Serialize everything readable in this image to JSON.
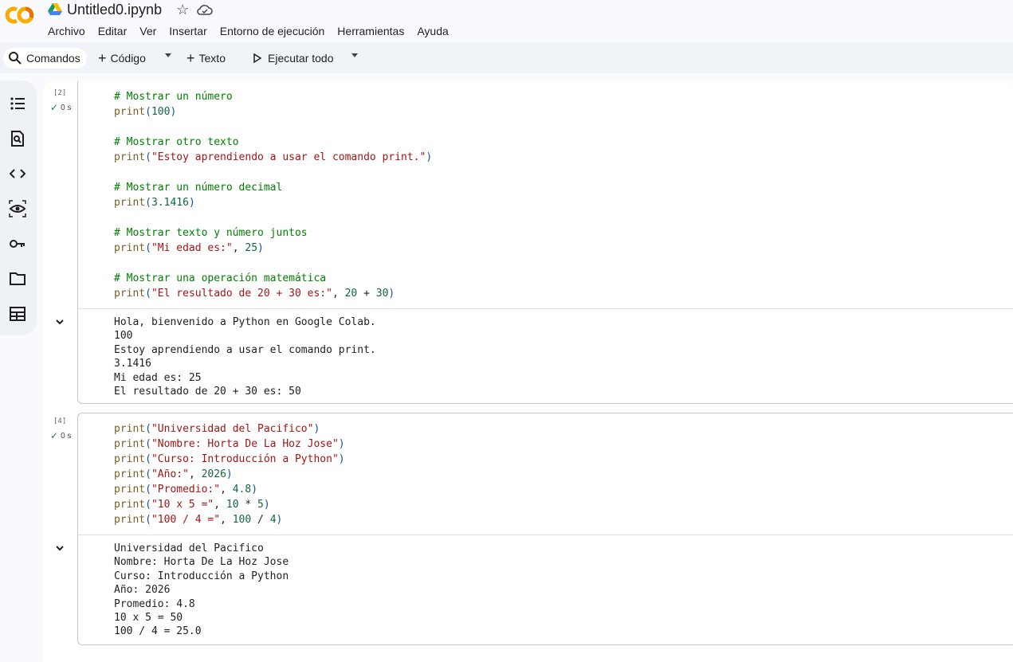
{
  "app": {
    "file_name": "Untitled0.ipynb"
  },
  "menu": [
    "Archivo",
    "Editar",
    "Ver",
    "Insertar",
    "Entorno de ejecución",
    "Herramientas",
    "Ayuda"
  ],
  "toolbar": {
    "commands": "Comandos",
    "code": "Código",
    "text": "Texto",
    "run_all": "Ejecutar todo"
  },
  "sidebar_icons": [
    "table-of-contents-icon",
    "find-replace-icon",
    "code-snippets-icon",
    "variables-icon",
    "secrets-key-icon",
    "files-icon",
    "data-table-icon"
  ],
  "cells": [
    {
      "exec_count": "[2]",
      "status": "0 s",
      "code": [
        {
          "t": "comment",
          "v": "# Mostrar un número"
        },
        {
          "t": "call",
          "fn": "print",
          "args": [
            {
              "t": "num",
              "v": "100"
            }
          ]
        },
        {
          "t": "blank"
        },
        {
          "t": "comment",
          "v": "# Mostrar otro texto"
        },
        {
          "t": "call",
          "fn": "print",
          "args": [
            {
              "t": "str",
              "v": "\"Estoy aprendiendo a usar el comando print.\""
            }
          ]
        },
        {
          "t": "blank"
        },
        {
          "t": "comment",
          "v": "# Mostrar un número decimal"
        },
        {
          "t": "call",
          "fn": "print",
          "args": [
            {
              "t": "num",
              "v": "3.1416"
            }
          ]
        },
        {
          "t": "blank"
        },
        {
          "t": "comment",
          "v": "# Mostrar texto y número juntos"
        },
        {
          "t": "call",
          "fn": "print",
          "args": [
            {
              "t": "str",
              "v": "\"Mi edad es:\""
            },
            {
              "t": "pn",
              "v": ", "
            },
            {
              "t": "num",
              "v": "25"
            }
          ]
        },
        {
          "t": "blank"
        },
        {
          "t": "comment",
          "v": "# Mostrar una operación matemática"
        },
        {
          "t": "call",
          "fn": "print",
          "args": [
            {
              "t": "str",
              "v": "\"El resultado de 20 + 30 es:\""
            },
            {
              "t": "pn",
              "v": ", "
            },
            {
              "t": "num",
              "v": "20"
            },
            {
              "t": "pn",
              "v": " + "
            },
            {
              "t": "num",
              "v": "30"
            }
          ]
        }
      ],
      "output": [
        "Hola, bienvenido a Python en Google Colab.",
        "100",
        "Estoy aprendiendo a usar el comando print.",
        "3.1416",
        "Mi edad es: 25",
        "El resultado de 20 + 30 es: 50"
      ]
    },
    {
      "exec_count": "[4]",
      "status": "0 s",
      "code": [
        {
          "t": "call",
          "fn": "print",
          "args": [
            {
              "t": "str",
              "v": "\"Universidad del Pacifico\""
            }
          ]
        },
        {
          "t": "call",
          "fn": "print",
          "args": [
            {
              "t": "str",
              "v": "\"Nombre: Horta De La Hoz Jose\""
            }
          ]
        },
        {
          "t": "call",
          "fn": "print",
          "args": [
            {
              "t": "str",
              "v": "\"Curso: Introducción a Python\""
            }
          ]
        },
        {
          "t": "call",
          "fn": "print",
          "args": [
            {
              "t": "str",
              "v": "\"Año:\""
            },
            {
              "t": "pn",
              "v": ", "
            },
            {
              "t": "num",
              "v": "2026"
            }
          ]
        },
        {
          "t": "call",
          "fn": "print",
          "args": [
            {
              "t": "str",
              "v": "\"Promedio:\""
            },
            {
              "t": "pn",
              "v": ", "
            },
            {
              "t": "num",
              "v": "4.8"
            }
          ]
        },
        {
          "t": "call",
          "fn": "print",
          "args": [
            {
              "t": "str",
              "v": "\"10 x 5 =\""
            },
            {
              "t": "pn",
              "v": ", "
            },
            {
              "t": "num",
              "v": "10"
            },
            {
              "t": "pn",
              "v": " * "
            },
            {
              "t": "num",
              "v": "5"
            }
          ]
        },
        {
          "t": "call",
          "fn": "print",
          "args": [
            {
              "t": "str",
              "v": "\"100 / 4 =\""
            },
            {
              "t": "pn",
              "v": ", "
            },
            {
              "t": "num",
              "v": "100"
            },
            {
              "t": "pn",
              "v": " / "
            },
            {
              "t": "num",
              "v": "4"
            }
          ]
        }
      ],
      "output": [
        "Universidad del Pacifico",
        "Nombre: Horta De La Hoz Jose",
        "Curso: Introducción a Python",
        "Año: 2026",
        "Promedio: 4.8",
        "10 x 5 = 50",
        "100 / 4 = 25.0"
      ]
    }
  ]
}
